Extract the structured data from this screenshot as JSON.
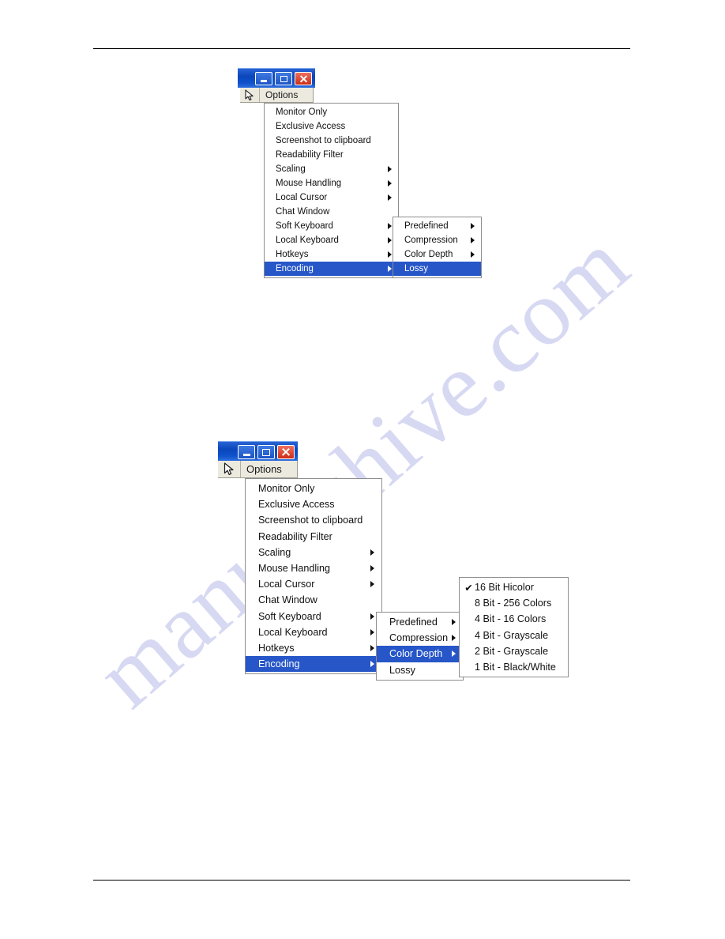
{
  "page": {
    "watermark": "manualshive.com",
    "rule_color": "#000000"
  },
  "screenshot_top": {
    "titlebar": {
      "minimize_label": "Minimize",
      "maximize_label": "Maximize",
      "close_label": "Close"
    },
    "menubar": {
      "cursor_icon": "mouse-pointer-icon",
      "label": "Options"
    },
    "menu": {
      "items": [
        {
          "label": "Monitor Only",
          "submenu": false,
          "selected": false
        },
        {
          "label": "Exclusive Access",
          "submenu": false,
          "selected": false
        },
        {
          "label": "Screenshot to clipboard",
          "submenu": false,
          "selected": false
        },
        {
          "label": "Readability Filter",
          "submenu": false,
          "selected": false
        },
        {
          "label": "Scaling",
          "submenu": true,
          "selected": false
        },
        {
          "label": "Mouse Handling",
          "submenu": true,
          "selected": false
        },
        {
          "label": "Local Cursor",
          "submenu": true,
          "selected": false
        },
        {
          "label": "Chat Window",
          "submenu": false,
          "selected": false
        },
        {
          "label": "Soft Keyboard",
          "submenu": true,
          "selected": false
        },
        {
          "label": "Local Keyboard",
          "submenu": true,
          "selected": false
        },
        {
          "label": "Hotkeys",
          "submenu": true,
          "selected": false
        },
        {
          "label": "Encoding",
          "submenu": true,
          "selected": true
        }
      ]
    },
    "submenu": {
      "items": [
        {
          "label": "Predefined",
          "submenu": true,
          "selected": false
        },
        {
          "label": "Compression",
          "submenu": true,
          "selected": false
        },
        {
          "label": "Color Depth",
          "submenu": true,
          "selected": false
        },
        {
          "label": "Lossy",
          "submenu": false,
          "selected": true
        }
      ]
    }
  },
  "screenshot_bottom": {
    "titlebar": {
      "minimize_label": "Minimize",
      "maximize_label": "Maximize",
      "close_label": "Close"
    },
    "menubar": {
      "cursor_icon": "mouse-pointer-icon",
      "label": "Options"
    },
    "menu": {
      "items": [
        {
          "label": "Monitor Only",
          "submenu": false,
          "selected": false
        },
        {
          "label": "Exclusive Access",
          "submenu": false,
          "selected": false
        },
        {
          "label": "Screenshot to clipboard",
          "submenu": false,
          "selected": false
        },
        {
          "label": "Readability Filter",
          "submenu": false,
          "selected": false
        },
        {
          "label": "Scaling",
          "submenu": true,
          "selected": false
        },
        {
          "label": "Mouse Handling",
          "submenu": true,
          "selected": false
        },
        {
          "label": "Local Cursor",
          "submenu": true,
          "selected": false
        },
        {
          "label": "Chat Window",
          "submenu": false,
          "selected": false
        },
        {
          "label": "Soft Keyboard",
          "submenu": true,
          "selected": false
        },
        {
          "label": "Local Keyboard",
          "submenu": true,
          "selected": false
        },
        {
          "label": "Hotkeys",
          "submenu": true,
          "selected": false
        },
        {
          "label": "Encoding",
          "submenu": true,
          "selected": true
        }
      ]
    },
    "submenu": {
      "items": [
        {
          "label": "Predefined",
          "submenu": true,
          "selected": false
        },
        {
          "label": "Compression",
          "submenu": true,
          "selected": false
        },
        {
          "label": "Color Depth",
          "submenu": true,
          "selected": true
        },
        {
          "label": "Lossy",
          "submenu": false,
          "selected": false
        }
      ]
    },
    "color_depth_menu": {
      "check_glyph": "✔",
      "items": [
        {
          "label": "16 Bit Hicolor",
          "checked": true
        },
        {
          "label": "8 Bit - 256 Colors",
          "checked": false
        },
        {
          "label": "4 Bit - 16 Colors",
          "checked": false
        },
        {
          "label": "4 Bit - Grayscale",
          "checked": false
        },
        {
          "label": "2 Bit - Grayscale",
          "checked": false
        },
        {
          "label": "1 Bit - Black/White",
          "checked": false
        }
      ]
    }
  },
  "colors": {
    "menu_highlight": "#2656c8",
    "titlebar_blue": "#0f52cc",
    "close_red": "#cc2e16",
    "menubar_bg": "#eceadf",
    "watermark": "#c9cbef"
  }
}
